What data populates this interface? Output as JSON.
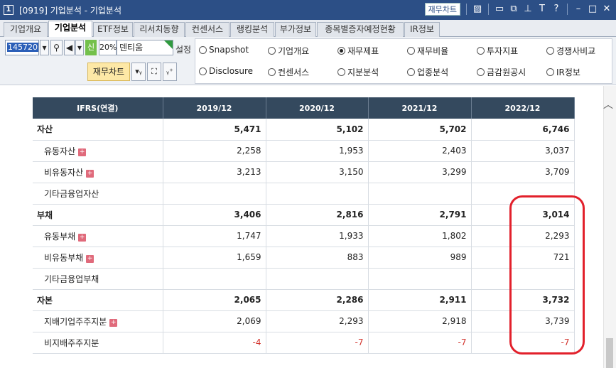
{
  "window": {
    "number": "1",
    "title": "[0919] 기업분석 - 기업분석",
    "fin_chart_button": "재무차트",
    "icons": [
      "chart-icon",
      "window-icon",
      "copy-icon",
      "pin-icon",
      "text-icon",
      "help-icon",
      "minimize-icon",
      "maximize-icon",
      "close-icon"
    ]
  },
  "tabs": [
    "기업개요",
    "기업분석",
    "ETF정보",
    "리서치동향",
    "컨센서스",
    "랭킹분석",
    "부가정보",
    "종목별증자예정현황",
    "IR정보"
  ],
  "active_tab": "기업분석",
  "toolbar": {
    "stock_code": "145720",
    "new_badge": "신",
    "percent": "20%",
    "company_name": "덴티움",
    "settings_label": "설정",
    "chart_button": "재무차트"
  },
  "radios": [
    {
      "label": "Snapshot",
      "selected": false
    },
    {
      "label": "기업개요",
      "selected": false
    },
    {
      "label": "재무제표",
      "selected": true
    },
    {
      "label": "재무비율",
      "selected": false
    },
    {
      "label": "투자지표",
      "selected": false
    },
    {
      "label": "경쟁사비교",
      "selected": false
    },
    {
      "label": "Disclosure",
      "selected": false
    },
    {
      "label": "컨센서스",
      "selected": false
    },
    {
      "label": "지분분석",
      "selected": false
    },
    {
      "label": "업종분석",
      "selected": false
    },
    {
      "label": "금감원공시",
      "selected": false
    },
    {
      "label": "IR정보",
      "selected": false
    }
  ],
  "table": {
    "header": [
      "IFRS(연결)",
      "2019/12",
      "2020/12",
      "2021/12",
      "2022/12"
    ],
    "rows": [
      {
        "label": "자산",
        "values": [
          "5,471",
          "5,102",
          "5,702",
          "6,746"
        ],
        "bold": true,
        "sub": false,
        "plus": false
      },
      {
        "label": "유동자산",
        "values": [
          "2,258",
          "1,953",
          "2,403",
          "3,037"
        ],
        "bold": false,
        "sub": true,
        "plus": true
      },
      {
        "label": "비유동자산",
        "values": [
          "3,213",
          "3,150",
          "3,299",
          "3,709"
        ],
        "bold": false,
        "sub": true,
        "plus": true
      },
      {
        "label": "기타금융업자산",
        "values": [
          "",
          "",
          "",
          ""
        ],
        "bold": false,
        "sub": true,
        "plus": false
      },
      {
        "label": "부채",
        "values": [
          "3,406",
          "2,816",
          "2,791",
          "3,014"
        ],
        "bold": true,
        "sub": false,
        "plus": false
      },
      {
        "label": "유동부채",
        "values": [
          "1,747",
          "1,933",
          "1,802",
          "2,293"
        ],
        "bold": false,
        "sub": true,
        "plus": true
      },
      {
        "label": "비유동부채",
        "values": [
          "1,659",
          "883",
          "989",
          "721"
        ],
        "bold": false,
        "sub": true,
        "plus": true
      },
      {
        "label": "기타금융업부채",
        "values": [
          "",
          "",
          "",
          ""
        ],
        "bold": false,
        "sub": true,
        "plus": false
      },
      {
        "label": "자본",
        "values": [
          "2,065",
          "2,286",
          "2,911",
          "3,732"
        ],
        "bold": true,
        "sub": false,
        "plus": false
      },
      {
        "label": "지배기업주주지분",
        "values": [
          "2,069",
          "2,293",
          "2,918",
          "3,739"
        ],
        "bold": false,
        "sub": true,
        "plus": true
      },
      {
        "label": "비지배주주지분",
        "values": [
          "-4",
          "-7",
          "-7",
          "-7"
        ],
        "bold": false,
        "sub": true,
        "plus": false
      }
    ]
  },
  "colors": {
    "titlebar": "#2c4f86",
    "table_header": "#34495e",
    "negative": "#d2332c",
    "highlight": "#e2202b"
  }
}
